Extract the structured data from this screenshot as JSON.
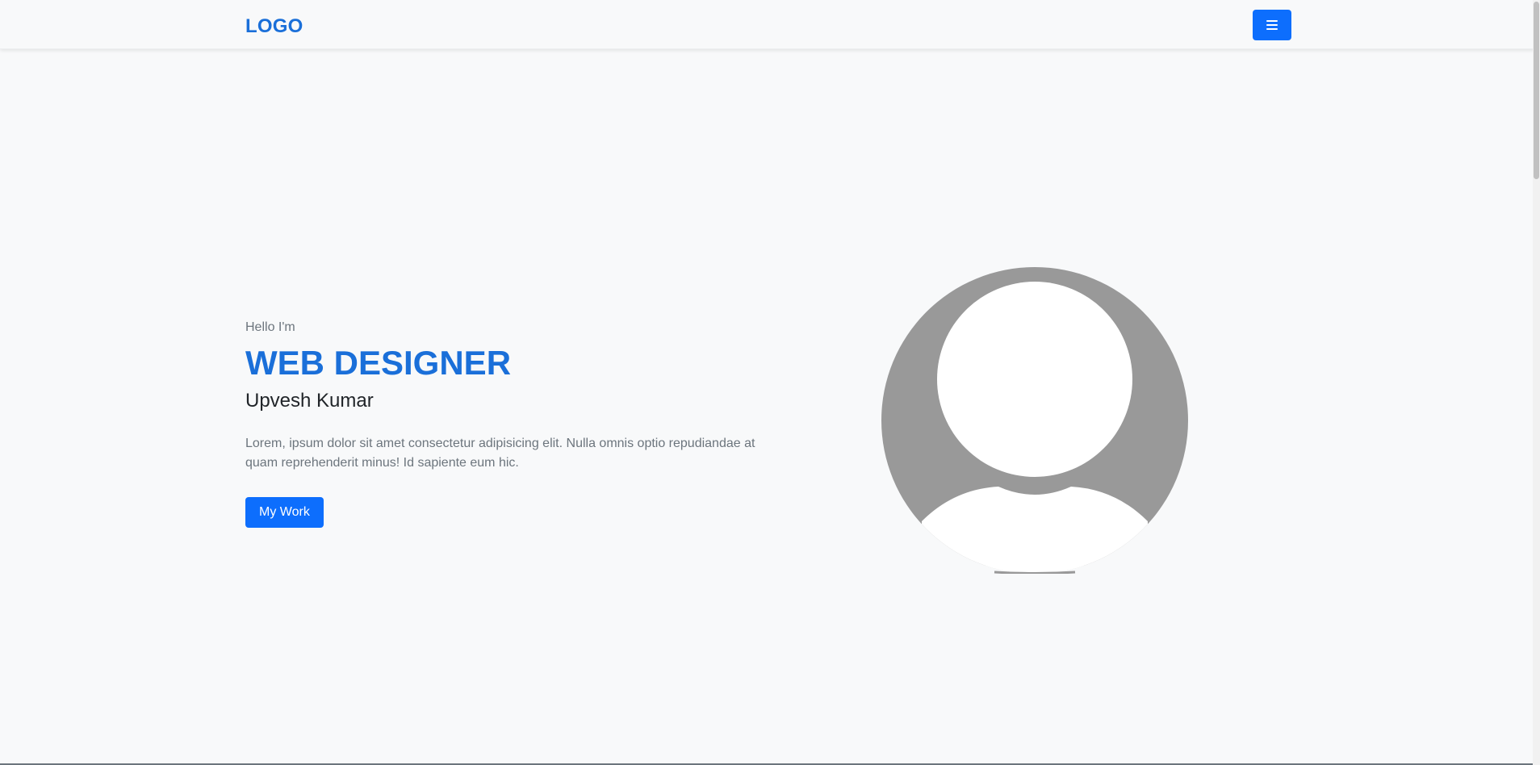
{
  "nav": {
    "logo": "LOGO",
    "menu_icon": "hamburger-menu-icon"
  },
  "hero": {
    "greeting": "Hello I'm",
    "title": "WEB DESIGNER",
    "name": "Upvesh Kumar",
    "description": "Lorem, ipsum dolor sit amet consectetur adipisicing elit. Nulla omnis optio repudiandae at quam reprehenderit minus! Id sapiente eum hic.",
    "button_label": "My Work",
    "avatar_icon": "user-avatar-placeholder-icon"
  },
  "colors": {
    "accent": "#0d6efd",
    "title": "#1a6fd9",
    "muted_text": "#6c757d",
    "background": "#f8f9fa",
    "avatar_gray": "#999999"
  }
}
